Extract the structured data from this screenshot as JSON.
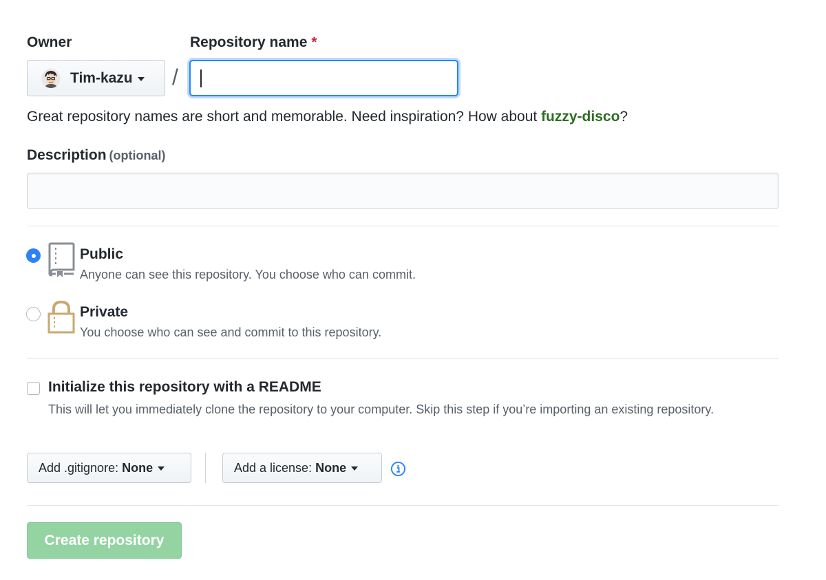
{
  "owner": {
    "label": "Owner",
    "name": "Tim-kazu"
  },
  "repo_name": {
    "label": "Repository name",
    "required_mark": "*",
    "value": "",
    "separator": "/"
  },
  "hint": {
    "prefix": "Great repository names are short and memorable. Need inspiration? How about ",
    "suggestion": "fuzzy-disco",
    "suffix": "?"
  },
  "description": {
    "label": "Description",
    "optional_label": "(optional)",
    "value": ""
  },
  "visibility": {
    "selected": "public",
    "options": [
      {
        "title": "Public",
        "description": "Anyone can see this repository. You choose who can commit.",
        "icon": "repo-book-icon"
      },
      {
        "title": "Private",
        "description": "You choose who can see and commit to this repository.",
        "icon": "lock-icon"
      }
    ]
  },
  "readme": {
    "checked": false,
    "title": "Initialize this repository with a README",
    "description": "This will let you immediately clone the repository to your computer. Skip this step if you’re importing an existing repository."
  },
  "gitignore": {
    "label": "Add .gitignore:",
    "value": "None"
  },
  "license": {
    "label": "Add a license:",
    "value": "None"
  },
  "info_icon": "info-icon",
  "create_button": {
    "label": "Create repository",
    "enabled": false
  },
  "colors": {
    "accent_blue": "#2f81f7",
    "suggestion_green": "#2c6e22",
    "create_disabled_green": "#94d3a2",
    "required_red": "#cb2431"
  }
}
